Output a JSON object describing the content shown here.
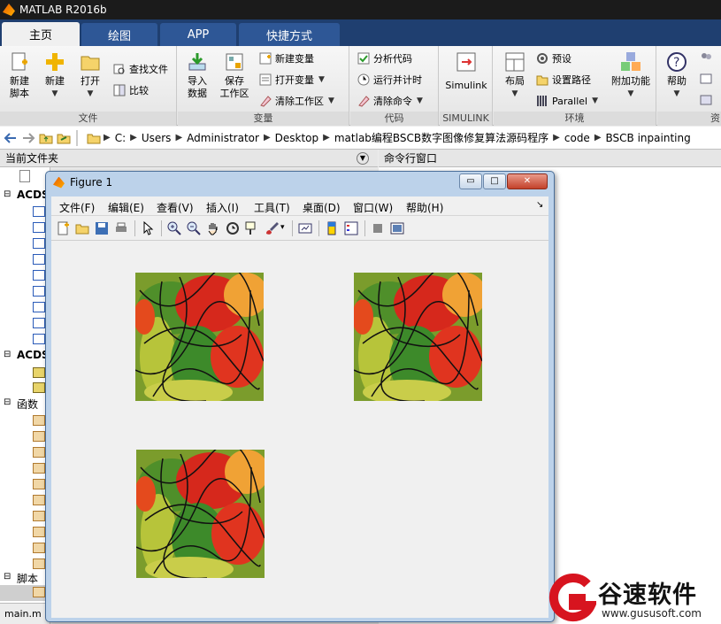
{
  "window": {
    "title": "MATLAB R2016b"
  },
  "tabs": [
    {
      "label": "主页",
      "active": true
    },
    {
      "label": "绘图",
      "active": false
    },
    {
      "label": "APP",
      "active": false
    },
    {
      "label": "快捷方式",
      "active": false
    }
  ],
  "ribbon": {
    "file": {
      "label": "文件",
      "new_script": "新建\n脚本",
      "new": "新建",
      "open": "打开",
      "find_files": "查找文件",
      "compare": "比较"
    },
    "variable": {
      "label": "变量",
      "import_data": "导入\n数据",
      "save_workspace": "保存\n工作区",
      "new_variable": "新建变量",
      "open_variable": "打开变量",
      "clear_workspace": "清除工作区"
    },
    "code": {
      "label": "代码",
      "analyze_code": "分析代码",
      "run_and_time": "运行并计时",
      "clear_commands": "清除命令"
    },
    "simulink": {
      "label": "SIMULINK",
      "button": "Simulink"
    },
    "environment": {
      "label": "环境",
      "layout": "布局",
      "preferences": "预设",
      "set_path": "设置路径",
      "parallel": "Parallel",
      "addons": "附加功能"
    },
    "resources": {
      "label": "资",
      "help": "帮助"
    }
  },
  "address": {
    "crumbs": [
      "C:",
      "Users",
      "Administrator",
      "Desktop",
      "matlab编程BSCB数字图像修复算法源码程序",
      "code",
      "BSCB inpainting"
    ]
  },
  "panels": {
    "current_folder": "当前文件夹",
    "command_window": "命令行窗口"
  },
  "tree": {
    "acdsee1": "ACDS",
    "acdsee2": "ACDS",
    "functions": "函数",
    "scripts": "脚本",
    "footer_file": "main.m"
  },
  "figure": {
    "title": "Figure 1",
    "menu": [
      "文件(F)",
      "编辑(E)",
      "查看(V)",
      "插入(I)",
      "工具(T)",
      "桌面(D)",
      "窗口(W)",
      "帮助(H)"
    ],
    "buttons": {
      "min": "▭",
      "max": "□",
      "close": "✕"
    }
  },
  "watermark": {
    "brand": "谷速软件",
    "url": "www.gususoft.com"
  },
  "colors": {
    "tab_bar": "#1f3f70",
    "figure_frame": "#bcd2ea",
    "watermark_red": "#d7141f"
  }
}
